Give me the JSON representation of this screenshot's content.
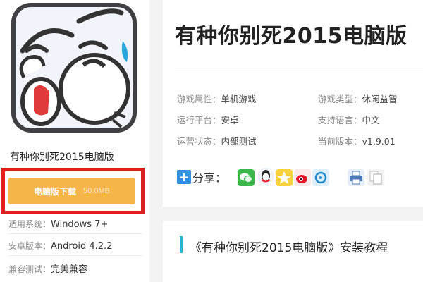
{
  "game": {
    "name": "有种你别死2015电脑版",
    "download_label": "电脑版下载",
    "download_size": "50.0MB"
  },
  "specs": [
    {
      "label": "适用系统：",
      "value": "Windows 7+"
    },
    {
      "label": "安卓版本：",
      "value": "Android 4.2.2"
    },
    {
      "label": "兼容测试：",
      "value": "完美兼容"
    }
  ],
  "header": {
    "title": "有种你别死2015电脑版"
  },
  "attributes": [
    {
      "label": "游戏属性：",
      "value": "单机游戏"
    },
    {
      "label": "游戏类型：",
      "value": "休闲益智"
    },
    {
      "label": "运行平台：",
      "value": "安卓"
    },
    {
      "label": "支持语言：",
      "value": "中文"
    },
    {
      "label": "运营状态：",
      "value": "内部测试"
    },
    {
      "label": "当前版本：",
      "value": "v1.9.01"
    }
  ],
  "share": {
    "label": "分享：",
    "icons": [
      "wechat-icon",
      "qq-icon",
      "qzone-icon",
      "weibo-icon",
      "tencent-weibo-icon",
      "print-icon",
      "copy-icon"
    ]
  },
  "section": {
    "title": "《有种你别死2015电脑版》安装教程"
  },
  "colors": {
    "download": "#f5b54a",
    "highlight": "#e02020",
    "section_bar": "#27b4d0",
    "share_plus": "#2f8fe3"
  }
}
